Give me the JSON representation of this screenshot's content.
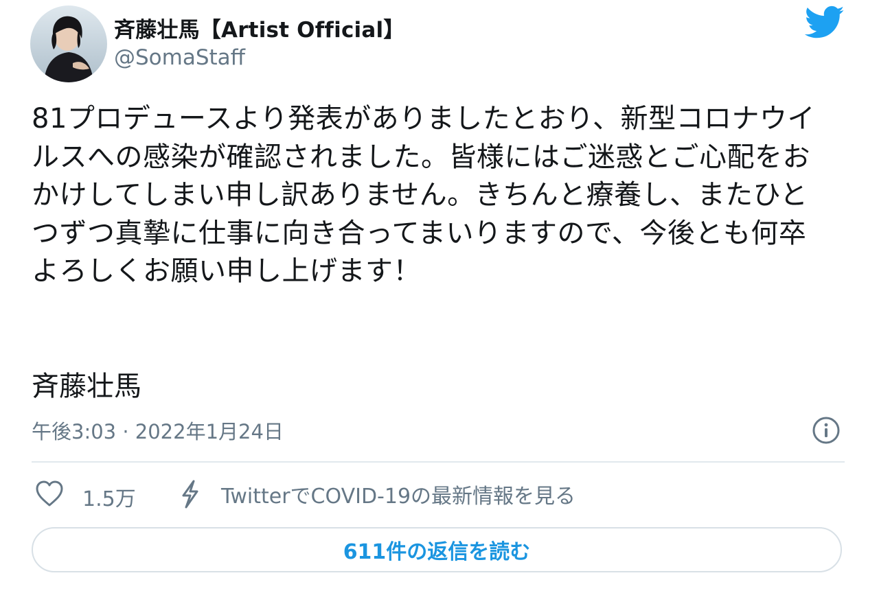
{
  "author": {
    "name": "斉藤壮馬【Artist Official】",
    "handle": "@SomaStaff",
    "avatar_icon": "avatar-image"
  },
  "tweet": {
    "body": "81プロデュースより発表がありましたとおり、新型コロナウイルスへの感染が確認されました。皆様にはご迷惑とご心配をおかけしてしまい申し訳ありません。きちんと療養し、またひとつずつ真摯に仕事に向き合ってまいりますので、今後とも何卒よろしくお願い申し上げます！",
    "signature": "斉藤壮馬",
    "timestamp": "午後3:03 · 2022年1月24日"
  },
  "actions": {
    "like_count": "1.5万",
    "covid_label": "TwitterでCOVID-19の最新情報を見る",
    "replies_label": "611件の返信を読む"
  },
  "icons": {
    "brand": "twitter-bird-icon",
    "like": "heart-icon",
    "covid": "lightning-icon",
    "info": "info-icon"
  },
  "colors": {
    "brand_blue": "#1da1f2",
    "link_blue": "#1b95e0",
    "secondary_text": "#657786",
    "border": "#e1e8ed"
  }
}
